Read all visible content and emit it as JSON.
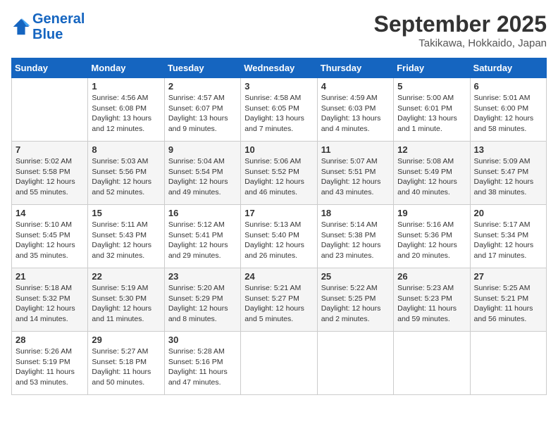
{
  "header": {
    "logo_line1": "General",
    "logo_line2": "Blue",
    "month": "September 2025",
    "location": "Takikawa, Hokkaido, Japan"
  },
  "weekdays": [
    "Sunday",
    "Monday",
    "Tuesday",
    "Wednesday",
    "Thursday",
    "Friday",
    "Saturday"
  ],
  "weeks": [
    [
      {
        "day": "",
        "info": ""
      },
      {
        "day": "1",
        "info": "Sunrise: 4:56 AM\nSunset: 6:08 PM\nDaylight: 13 hours\nand 12 minutes."
      },
      {
        "day": "2",
        "info": "Sunrise: 4:57 AM\nSunset: 6:07 PM\nDaylight: 13 hours\nand 9 minutes."
      },
      {
        "day": "3",
        "info": "Sunrise: 4:58 AM\nSunset: 6:05 PM\nDaylight: 13 hours\nand 7 minutes."
      },
      {
        "day": "4",
        "info": "Sunrise: 4:59 AM\nSunset: 6:03 PM\nDaylight: 13 hours\nand 4 minutes."
      },
      {
        "day": "5",
        "info": "Sunrise: 5:00 AM\nSunset: 6:01 PM\nDaylight: 13 hours\nand 1 minute."
      },
      {
        "day": "6",
        "info": "Sunrise: 5:01 AM\nSunset: 6:00 PM\nDaylight: 12 hours\nand 58 minutes."
      }
    ],
    [
      {
        "day": "7",
        "info": "Sunrise: 5:02 AM\nSunset: 5:58 PM\nDaylight: 12 hours\nand 55 minutes."
      },
      {
        "day": "8",
        "info": "Sunrise: 5:03 AM\nSunset: 5:56 PM\nDaylight: 12 hours\nand 52 minutes."
      },
      {
        "day": "9",
        "info": "Sunrise: 5:04 AM\nSunset: 5:54 PM\nDaylight: 12 hours\nand 49 minutes."
      },
      {
        "day": "10",
        "info": "Sunrise: 5:06 AM\nSunset: 5:52 PM\nDaylight: 12 hours\nand 46 minutes."
      },
      {
        "day": "11",
        "info": "Sunrise: 5:07 AM\nSunset: 5:51 PM\nDaylight: 12 hours\nand 43 minutes."
      },
      {
        "day": "12",
        "info": "Sunrise: 5:08 AM\nSunset: 5:49 PM\nDaylight: 12 hours\nand 40 minutes."
      },
      {
        "day": "13",
        "info": "Sunrise: 5:09 AM\nSunset: 5:47 PM\nDaylight: 12 hours\nand 38 minutes."
      }
    ],
    [
      {
        "day": "14",
        "info": "Sunrise: 5:10 AM\nSunset: 5:45 PM\nDaylight: 12 hours\nand 35 minutes."
      },
      {
        "day": "15",
        "info": "Sunrise: 5:11 AM\nSunset: 5:43 PM\nDaylight: 12 hours\nand 32 minutes."
      },
      {
        "day": "16",
        "info": "Sunrise: 5:12 AM\nSunset: 5:41 PM\nDaylight: 12 hours\nand 29 minutes."
      },
      {
        "day": "17",
        "info": "Sunrise: 5:13 AM\nSunset: 5:40 PM\nDaylight: 12 hours\nand 26 minutes."
      },
      {
        "day": "18",
        "info": "Sunrise: 5:14 AM\nSunset: 5:38 PM\nDaylight: 12 hours\nand 23 minutes."
      },
      {
        "day": "19",
        "info": "Sunrise: 5:16 AM\nSunset: 5:36 PM\nDaylight: 12 hours\nand 20 minutes."
      },
      {
        "day": "20",
        "info": "Sunrise: 5:17 AM\nSunset: 5:34 PM\nDaylight: 12 hours\nand 17 minutes."
      }
    ],
    [
      {
        "day": "21",
        "info": "Sunrise: 5:18 AM\nSunset: 5:32 PM\nDaylight: 12 hours\nand 14 minutes."
      },
      {
        "day": "22",
        "info": "Sunrise: 5:19 AM\nSunset: 5:30 PM\nDaylight: 12 hours\nand 11 minutes."
      },
      {
        "day": "23",
        "info": "Sunrise: 5:20 AM\nSunset: 5:29 PM\nDaylight: 12 hours\nand 8 minutes."
      },
      {
        "day": "24",
        "info": "Sunrise: 5:21 AM\nSunset: 5:27 PM\nDaylight: 12 hours\nand 5 minutes."
      },
      {
        "day": "25",
        "info": "Sunrise: 5:22 AM\nSunset: 5:25 PM\nDaylight: 12 hours\nand 2 minutes."
      },
      {
        "day": "26",
        "info": "Sunrise: 5:23 AM\nSunset: 5:23 PM\nDaylight: 11 hours\nand 59 minutes."
      },
      {
        "day": "27",
        "info": "Sunrise: 5:25 AM\nSunset: 5:21 PM\nDaylight: 11 hours\nand 56 minutes."
      }
    ],
    [
      {
        "day": "28",
        "info": "Sunrise: 5:26 AM\nSunset: 5:19 PM\nDaylight: 11 hours\nand 53 minutes."
      },
      {
        "day": "29",
        "info": "Sunrise: 5:27 AM\nSunset: 5:18 PM\nDaylight: 11 hours\nand 50 minutes."
      },
      {
        "day": "30",
        "info": "Sunrise: 5:28 AM\nSunset: 5:16 PM\nDaylight: 11 hours\nand 47 minutes."
      },
      {
        "day": "",
        "info": ""
      },
      {
        "day": "",
        "info": ""
      },
      {
        "day": "",
        "info": ""
      },
      {
        "day": "",
        "info": ""
      }
    ]
  ]
}
